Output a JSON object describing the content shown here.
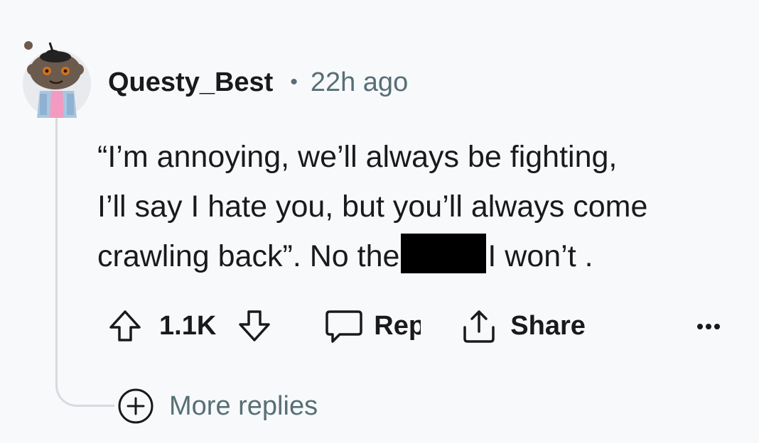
{
  "comment": {
    "username": "Questy_Best",
    "separator": "•",
    "timestamp": "22h ago",
    "body_lines": {
      "line1": "“I’m annoying, we’ll always be fighting,",
      "line2": "I’ll say I hate you, but you’ll always come",
      "line3_before": "crawling back”. No the",
      "line3_after": "I won’t ."
    }
  },
  "actions": {
    "upvote_icon": "upvote-arrow-icon",
    "vote_count": "1.1K",
    "downvote_icon": "downvote-arrow-icon",
    "reply_icon": "speech-bubble-icon",
    "reply_label": "Rep",
    "share_icon": "share-upload-icon",
    "share_label": "Share",
    "more_icon": "ellipsis-icon"
  },
  "more_replies": {
    "icon": "plus-circle-icon",
    "label": "More replies"
  },
  "colors": {
    "background": "#f8f9fb",
    "text_primary": "#1a1a1b",
    "text_secondary": "#576f76",
    "thread_line": "#d7dadf",
    "redaction": "#000000"
  }
}
